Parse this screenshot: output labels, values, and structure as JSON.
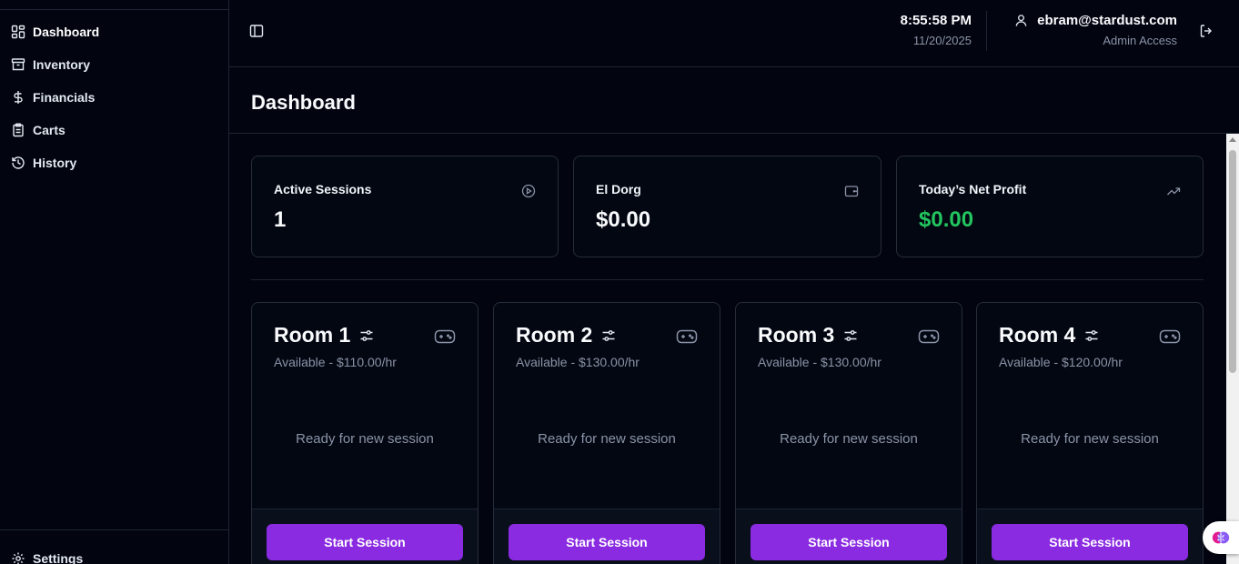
{
  "sidebar": {
    "items": [
      {
        "label": "Dashboard",
        "icon": "layout-grid-icon",
        "active": true
      },
      {
        "label": "Inventory",
        "icon": "archive-box-icon"
      },
      {
        "label": "Financials",
        "icon": "dollar-icon"
      },
      {
        "label": "Carts",
        "icon": "clipboard-list-icon"
      },
      {
        "label": "History",
        "icon": "history-icon"
      }
    ],
    "settings_label": "Settings"
  },
  "header": {
    "time": "8:55:58 PM",
    "date": "11/20/2025",
    "user_email": "ebram@stardust.com",
    "user_role": "Admin Access"
  },
  "page": {
    "title": "Dashboard"
  },
  "stats": [
    {
      "label": "Active Sessions",
      "value": "1",
      "icon": "play-circle-icon"
    },
    {
      "label": "El Dorg",
      "value": "$0.00",
      "icon": "wallet-icon"
    },
    {
      "label": "Today’s Net Profit",
      "value": "$0.00",
      "icon": "trending-up-icon",
      "value_color": "#22c55e"
    }
  ],
  "rooms": [
    {
      "name": "Room 1",
      "status": "Available - $110.00/hr",
      "empty_text": "Ready for new session",
      "button": "Start Session"
    },
    {
      "name": "Room 2",
      "status": "Available - $130.00/hr",
      "empty_text": "Ready for new session",
      "button": "Start Session"
    },
    {
      "name": "Room 3",
      "status": "Available - $130.00/hr",
      "empty_text": "Ready for new session",
      "button": "Start Session"
    },
    {
      "name": "Room 4",
      "status": "Available - $120.00/hr",
      "empty_text": "Ready for new session",
      "button": "Start Session"
    }
  ],
  "colors": {
    "accent": "#8a2be2",
    "profit": "#22c55e",
    "background": "#020510"
  }
}
